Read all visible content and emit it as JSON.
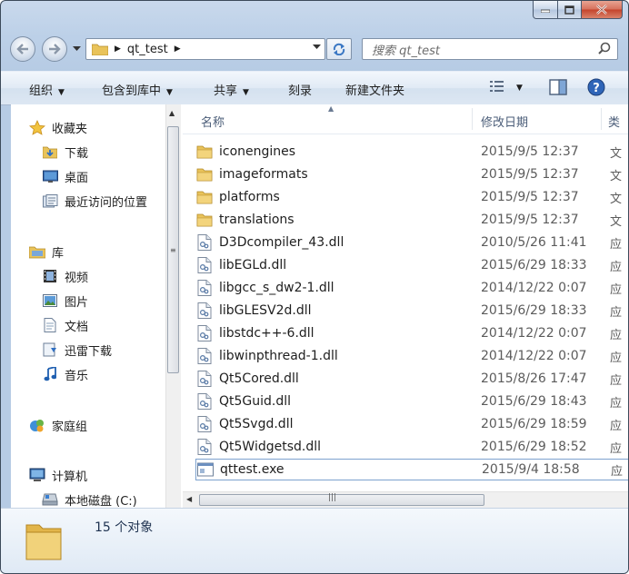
{
  "window": {
    "caption_buttons": [
      "minimize",
      "maximize",
      "close"
    ]
  },
  "address": {
    "crumb": "qt_test",
    "search_placeholder": "搜索 qt_test"
  },
  "toolbar": {
    "organize": "组织",
    "include_in_library": "包含到库中",
    "share": "共享",
    "burn": "刻录",
    "new_folder": "新建文件夹"
  },
  "nav": {
    "favorites": "收藏夹",
    "downloads": "下载",
    "desktop": "桌面",
    "recent": "最近访问的位置",
    "libraries": "库",
    "videos": "视频",
    "pictures": "图片",
    "documents": "文档",
    "xunlei": "迅雷下载",
    "music": "音乐",
    "homegroup": "家庭组",
    "computer": "计算机",
    "local_disk": "本地磁盘 (C:)"
  },
  "columns": {
    "name": "名称",
    "date": "修改日期",
    "type": "类"
  },
  "files": [
    {
      "name": "iconengines",
      "date": "2015/9/5 12:37",
      "type": "文",
      "kind": "folder"
    },
    {
      "name": "imageformats",
      "date": "2015/9/5 12:37",
      "type": "文",
      "kind": "folder"
    },
    {
      "name": "platforms",
      "date": "2015/9/5 12:37",
      "type": "文",
      "kind": "folder"
    },
    {
      "name": "translations",
      "date": "2015/9/5 12:37",
      "type": "文",
      "kind": "folder"
    },
    {
      "name": "D3Dcompiler_43.dll",
      "date": "2010/5/26 11:41",
      "type": "应",
      "kind": "dll"
    },
    {
      "name": "libEGLd.dll",
      "date": "2015/6/29 18:33",
      "type": "应",
      "kind": "dll"
    },
    {
      "name": "libgcc_s_dw2-1.dll",
      "date": "2014/12/22 0:07",
      "type": "应",
      "kind": "dll"
    },
    {
      "name": "libGLESV2d.dll",
      "date": "2015/6/29 18:33",
      "type": "应",
      "kind": "dll"
    },
    {
      "name": "libstdc++-6.dll",
      "date": "2014/12/22 0:07",
      "type": "应",
      "kind": "dll"
    },
    {
      "name": "libwinpthread-1.dll",
      "date": "2014/12/22 0:07",
      "type": "应",
      "kind": "dll"
    },
    {
      "name": "Qt5Cored.dll",
      "date": "2015/8/26 17:47",
      "type": "应",
      "kind": "dll"
    },
    {
      "name": "Qt5Guid.dll",
      "date": "2015/6/29 18:43",
      "type": "应",
      "kind": "dll"
    },
    {
      "name": "Qt5Svgd.dll",
      "date": "2015/6/29 18:59",
      "type": "应",
      "kind": "dll"
    },
    {
      "name": "Qt5Widgetsd.dll",
      "date": "2015/6/29 18:52",
      "type": "应",
      "kind": "dll"
    },
    {
      "name": "qttest.exe",
      "date": "2015/9/4 18:58",
      "type": "应",
      "kind": "exe",
      "selected": true
    }
  ],
  "status": {
    "count": "15 个对象"
  },
  "colors": {
    "frame": "#b6cbe4",
    "folder": "#e9c35a",
    "selection_border": "#7da2ce"
  }
}
